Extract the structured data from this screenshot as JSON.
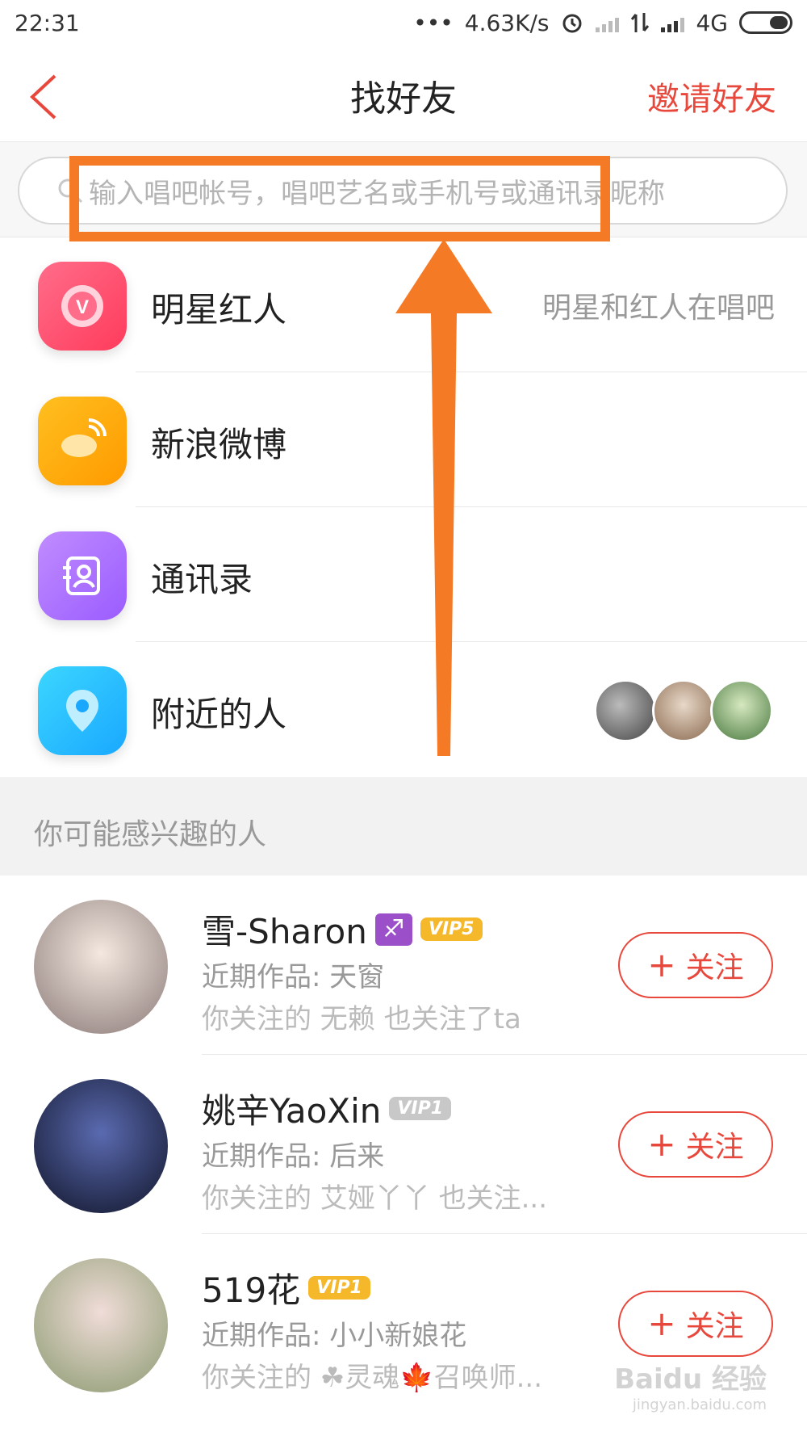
{
  "status_bar": {
    "time": "22:31",
    "dots": "•••",
    "speed": "4.63K/s",
    "network": "4G"
  },
  "header": {
    "title": "找好友",
    "invite_label": "邀请好友"
  },
  "search": {
    "placeholder": "输入唱吧帐号，唱吧艺名或手机号或通讯录昵称"
  },
  "menu": [
    {
      "label": "明星红人",
      "desc": "明星和红人在唱吧",
      "icon": "star-v-icon",
      "color_from": "#ff5f7e",
      "color_to": "#ff3b5c"
    },
    {
      "label": "新浪微博",
      "desc": "",
      "icon": "weibo-icon",
      "color_from": "#ffb300",
      "color_to": "#ff9a00"
    },
    {
      "label": "通讯录",
      "desc": "",
      "icon": "contacts-icon",
      "color_from": "#b57cff",
      "color_to": "#9a5cff"
    },
    {
      "label": "附近的人",
      "desc": "",
      "icon": "location-pin-icon",
      "color_from": "#2ad0ff",
      "color_to": "#1aa8ff"
    }
  ],
  "section_title": "你可能感兴趣的人",
  "users": [
    {
      "name": "雪-Sharon",
      "emoji": "♐",
      "vip": "VIP5",
      "vip_color": "gold",
      "works": "近期作品: 天窗",
      "mutual": "你关注的  无赖   也关注了ta",
      "follow_label": "关注"
    },
    {
      "name": "姚辛YaoXin",
      "emoji": "",
      "vip": "VIP1",
      "vip_color": "gray",
      "works": "近期作品: 后来",
      "mutual": "你关注的 艾娅丫丫 也关注...",
      "follow_label": "关注"
    },
    {
      "name": "519花",
      "emoji": "",
      "vip": "VIP1",
      "vip_color": "gold",
      "works": "近期作品: 小小新娘花",
      "mutual": "你关注的 ☘灵魂🍁召唤师...",
      "follow_label": "关注"
    }
  ],
  "watermark": {
    "main": "Baidu 经验",
    "sub": "jingyan.baidu.com"
  },
  "colors": {
    "accent": "#e8483c",
    "annotation": "#f47a25"
  }
}
